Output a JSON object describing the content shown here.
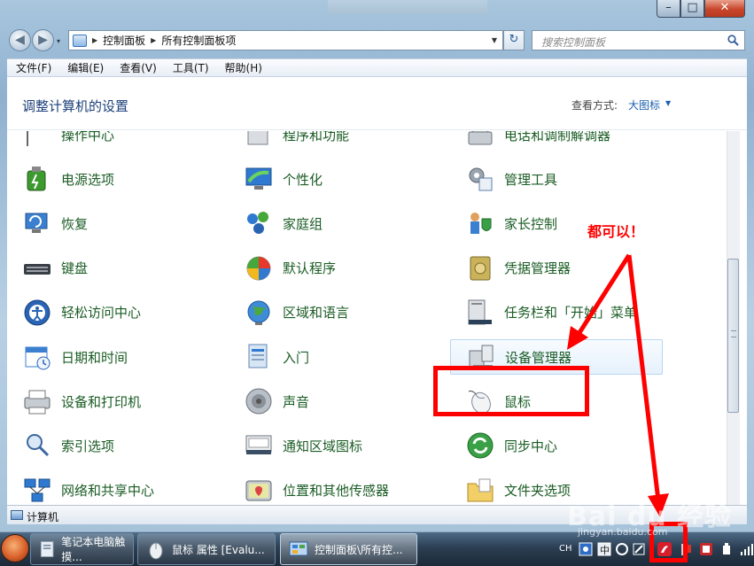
{
  "window": {
    "minimize": "–",
    "maximize": "□",
    "close": "✕"
  },
  "nav": {
    "back": "◀",
    "forward": "▶",
    "history": "▾",
    "breadcrumbs": [
      "控制面板",
      "所有控制面板项"
    ],
    "refresh": "↻",
    "search_placeholder": "搜索控制面板"
  },
  "menu": [
    "文件(F)",
    "编辑(E)",
    "查看(V)",
    "工具(T)",
    "帮助(H)"
  ],
  "content": {
    "title": "调整计算机的设置",
    "view_label": "查看方式:",
    "view_value": "大图标"
  },
  "items": [
    {
      "label": "操作中心",
      "icon": "flag-icon",
      "col": 0,
      "row": 0
    },
    {
      "label": "程序和功能",
      "icon": "programs-icon",
      "col": 1,
      "row": 0
    },
    {
      "label": "电话和调制解调器",
      "icon": "phone-modem-icon",
      "col": 2,
      "row": 0
    },
    {
      "label": "电源选项",
      "icon": "power-icon",
      "col": 0,
      "row": 1
    },
    {
      "label": "个性化",
      "icon": "personalize-icon",
      "col": 1,
      "row": 1
    },
    {
      "label": "管理工具",
      "icon": "admin-tools-icon",
      "col": 2,
      "row": 1
    },
    {
      "label": "恢复",
      "icon": "recovery-icon",
      "col": 0,
      "row": 2
    },
    {
      "label": "家庭组",
      "icon": "homegroup-icon",
      "col": 1,
      "row": 2
    },
    {
      "label": "家长控制",
      "icon": "parental-icon",
      "col": 2,
      "row": 2
    },
    {
      "label": "键盘",
      "icon": "keyboard-icon",
      "col": 0,
      "row": 3
    },
    {
      "label": "默认程序",
      "icon": "default-programs-icon",
      "col": 1,
      "row": 3
    },
    {
      "label": "凭据管理器",
      "icon": "credential-icon",
      "col": 2,
      "row": 3
    },
    {
      "label": "轻松访问中心",
      "icon": "ease-access-icon",
      "col": 0,
      "row": 4
    },
    {
      "label": "区域和语言",
      "icon": "globe-icon",
      "col": 1,
      "row": 4
    },
    {
      "label": "任务栏和「开始」菜单",
      "icon": "taskbar-icon",
      "col": 2,
      "row": 4
    },
    {
      "label": "日期和时间",
      "icon": "calendar-icon",
      "col": 0,
      "row": 5
    },
    {
      "label": "入门",
      "icon": "getting-started-icon",
      "col": 1,
      "row": 5
    },
    {
      "label": "设备管理器",
      "icon": "device-manager-icon",
      "col": 2,
      "row": 5
    },
    {
      "label": "设备和打印机",
      "icon": "printer-icon",
      "col": 0,
      "row": 6
    },
    {
      "label": "声音",
      "icon": "speaker-icon",
      "col": 1,
      "row": 6
    },
    {
      "label": "鼠标",
      "icon": "mouse-icon",
      "col": 2,
      "row": 6
    },
    {
      "label": "索引选项",
      "icon": "index-icon",
      "col": 0,
      "row": 7
    },
    {
      "label": "通知区域图标",
      "icon": "notify-icon",
      "col": 1,
      "row": 7
    },
    {
      "label": "同步中心",
      "icon": "sync-icon",
      "col": 2,
      "row": 7
    },
    {
      "label": "网络和共享中心",
      "icon": "network-icon",
      "col": 0,
      "row": 8
    },
    {
      "label": "位置和其他传感器",
      "icon": "location-icon",
      "col": 1,
      "row": 8
    },
    {
      "label": "文件夹选项",
      "icon": "folder-icon",
      "col": 2,
      "row": 8
    }
  ],
  "status": {
    "text": "计算机"
  },
  "taskbar": {
    "tasks": [
      "笔记本电脑触摸...",
      "鼠标 属性 [Evalu...",
      "控制面板\\所有控..."
    ],
    "tray_lang": "CH"
  },
  "annotation": {
    "note": "都可以！"
  },
  "watermark": {
    "main": "Bai du 经验",
    "sub": "jingyan.baidu.com"
  },
  "colors": {
    "link_green": "#1a5c24",
    "title_blue": "#1b3f7a",
    "annotation_red": "#ff0000"
  }
}
